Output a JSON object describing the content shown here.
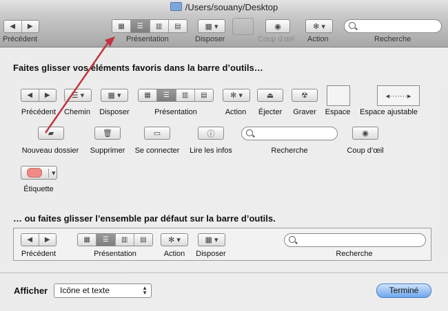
{
  "window": {
    "title": "/Users/souany/Desktop"
  },
  "toolbar": {
    "back_label": "Précédent",
    "view_label": "Présentation",
    "arrange_label": "Disposer",
    "quicklook_label": "Coup d’œil",
    "action_label": "Action",
    "search_label": "Recherche"
  },
  "sheet": {
    "heading_favorites": "Faites glisser vos éléments favoris dans la barre d’outils…",
    "heading_default": "… ou faites glisser l’ensemble par défaut sur la barre d’outils.",
    "items": {
      "back": "Précédent",
      "path": "Chemin",
      "arrange": "Disposer",
      "view": "Présentation",
      "action": "Action",
      "eject": "Éjecter",
      "burn": "Graver",
      "space": "Espace",
      "flex_space": "Espace ajustable",
      "new_folder": "Nouveau dossier",
      "delete": "Supprimer",
      "connect": "Se connecter",
      "get_info": "Lire les infos",
      "search": "Recherche",
      "quicklook": "Coup d’œil",
      "label": "Étiquette"
    },
    "default_set": {
      "back": "Précédent",
      "view": "Présentation",
      "action": "Action",
      "arrange": "Disposer",
      "search": "Recherche"
    },
    "show_label": "Afficher",
    "show_value": "Icône et texte",
    "done_button": "Terminé"
  },
  "colors": {
    "annotation_arrow": "#c0343f",
    "done_button": "#6ea7ec",
    "label_swatch": "#f08a86"
  }
}
